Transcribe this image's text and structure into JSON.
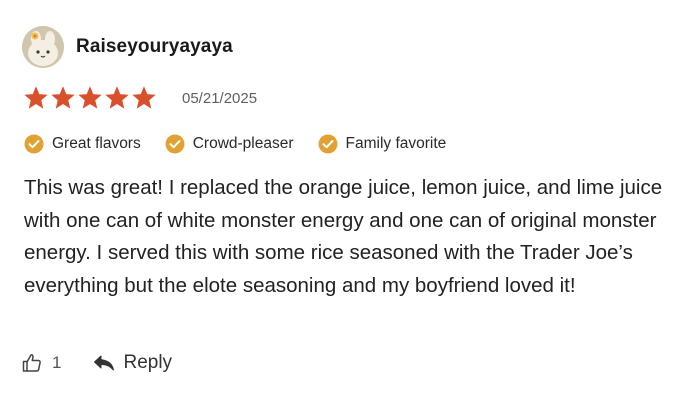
{
  "review": {
    "username": "Raiseyouryayaya",
    "rating": 5,
    "rating_max": 5,
    "date": "05/21/2025",
    "tags": [
      {
        "label": "Great flavors",
        "icon": "check-circle-icon"
      },
      {
        "label": "Crowd-pleaser",
        "icon": "check-circle-icon"
      },
      {
        "label": "Family favorite",
        "icon": "check-circle-icon"
      }
    ],
    "text": "This was great! I replaced the orange juice, lemon juice, and lime juice with one can of white monster energy and one can of original monster energy. I served this with some rice seasoned with the Trader Joe’s everything but the elote seasoning and my boyfriend loved it!",
    "likes": "1",
    "reply_label": "Reply"
  },
  "colors": {
    "star": "#d9512c",
    "tag_check": "#e0a233",
    "text": "#222222",
    "muted": "#5f5f5f"
  }
}
